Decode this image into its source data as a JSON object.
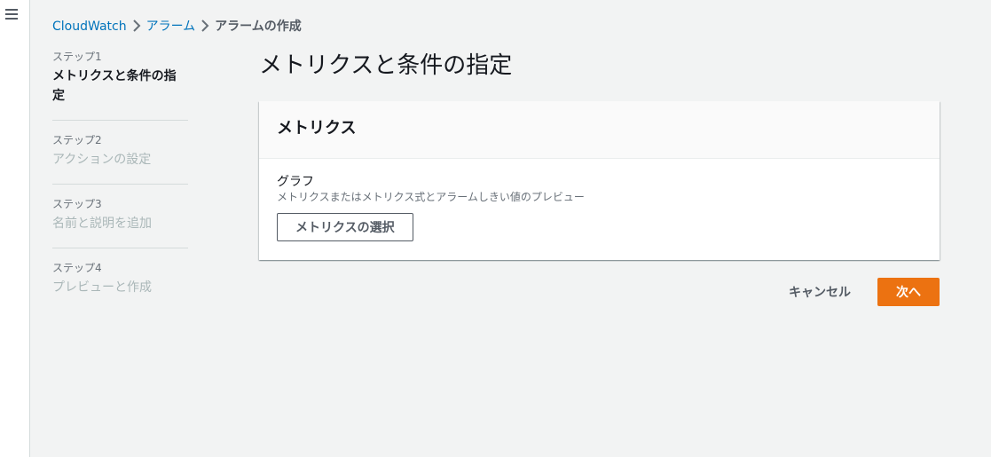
{
  "breadcrumb": {
    "items": [
      {
        "label": "CloudWatch"
      },
      {
        "label": "アラーム"
      }
    ],
    "current": "アラームの作成"
  },
  "steps": [
    {
      "label": "ステップ1",
      "title": "メトリクスと条件の指定",
      "active": true
    },
    {
      "label": "ステップ2",
      "title": "アクションの設定",
      "active": false
    },
    {
      "label": "ステップ3",
      "title": "名前と説明を追加",
      "active": false
    },
    {
      "label": "ステップ4",
      "title": "プレビューと作成",
      "active": false
    }
  ],
  "page": {
    "title": "メトリクスと条件の指定"
  },
  "metrics_panel": {
    "header": "メトリクス",
    "graph_label": "グラフ",
    "graph_description": "メトリクスまたはメトリクス式とアラームしきい値のプレビュー",
    "select_button": "メトリクスの選択"
  },
  "footer": {
    "cancel_label": "キャンセル",
    "next_label": "次へ"
  },
  "colors": {
    "primary": "#ec7211",
    "link": "#0073bb",
    "background": "#f2f3f3"
  }
}
